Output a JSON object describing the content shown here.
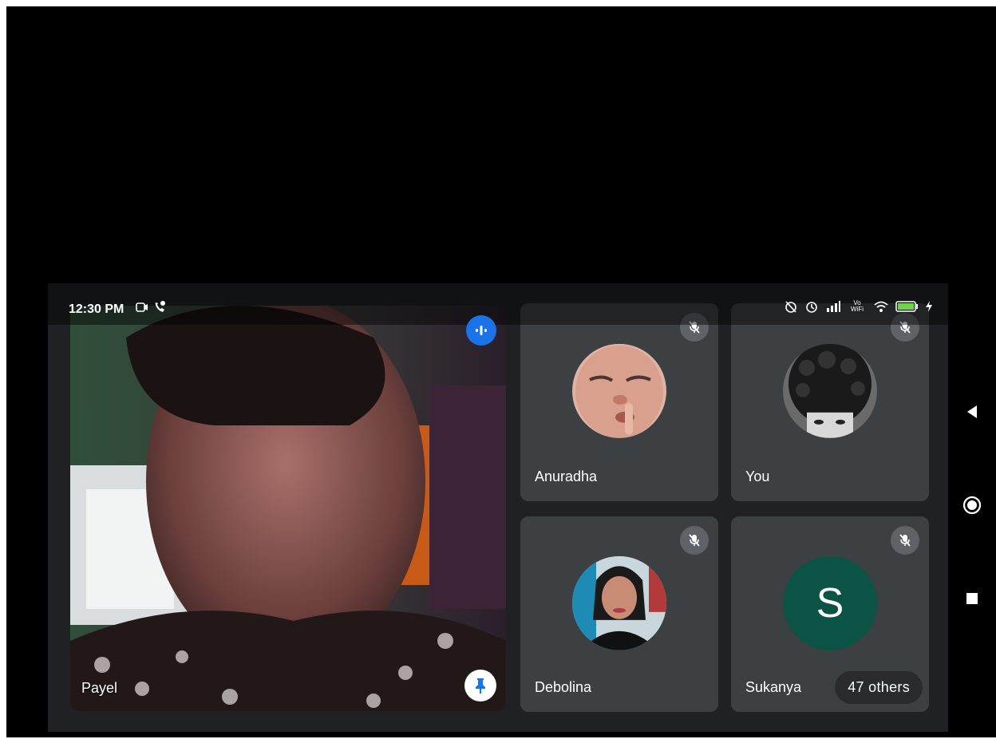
{
  "status_bar": {
    "time": "12:30 PM",
    "right_text": "Vo WiFi"
  },
  "main_tile": {
    "name": "Payel",
    "pinned": true
  },
  "participants": [
    {
      "name": "Anuradha",
      "muted": true
    },
    {
      "name": "You",
      "muted": true
    },
    {
      "name": "Debolina",
      "muted": true
    },
    {
      "name": "Sukanya",
      "muted": true,
      "initial": "S"
    }
  ],
  "others_chip": {
    "label": "47 others"
  },
  "colors": {
    "accent": "#1a73e8",
    "sukanya_avatar": "#0b5345"
  },
  "icons": {
    "nav": [
      "back-icon",
      "home-icon",
      "recents-icon"
    ]
  }
}
